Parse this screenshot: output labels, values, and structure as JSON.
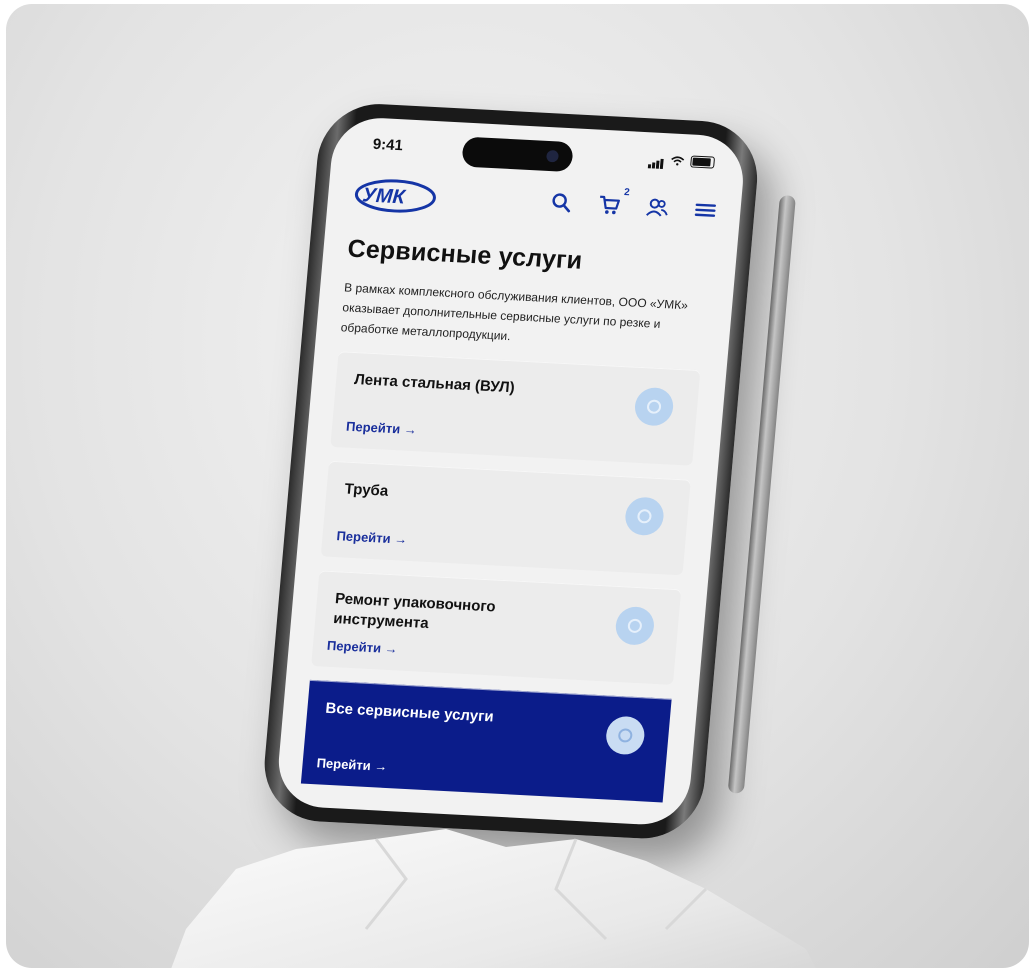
{
  "status": {
    "time": "9:41"
  },
  "header": {
    "logo_text": "УМК",
    "cart_count": "2"
  },
  "page": {
    "title": "Сервисные услуги",
    "description": "В рамках комплексного обслуживания клиентов, ООО «УМК» оказывает дополнительные сервисные услуги по резке и обработке металлопродукции."
  },
  "cards": [
    {
      "title": "Лента стальная (ВУЛ)",
      "link": "Перейти →"
    },
    {
      "title": "Труба",
      "link": "Перейти →"
    },
    {
      "title": "Ремонт упаковочного инструмента",
      "link": "Перейти →"
    },
    {
      "title": "Все сервисные услуги",
      "link": "Перейти →"
    }
  ],
  "colors": {
    "brand": "#0b1c8a",
    "accent_light": "#b8d3f0"
  }
}
